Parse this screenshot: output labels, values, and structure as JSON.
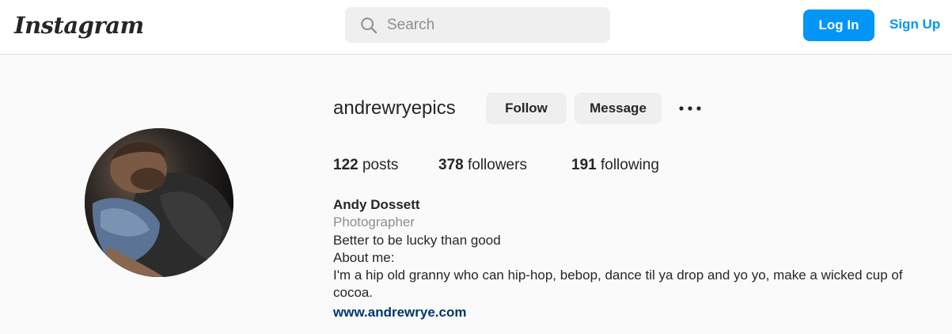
{
  "header": {
    "logo_text": "Instagram",
    "search": {
      "placeholder": "Search",
      "value": "",
      "icon": "search-icon"
    },
    "login_label": "Log In",
    "signup_label": "Sign Up"
  },
  "profile": {
    "username": "andrewryepics",
    "follow_label": "Follow",
    "message_label": "Message",
    "more_icon": "more-options-icon",
    "stats": {
      "posts_count": "122",
      "posts_label": "posts",
      "followers_count": "378",
      "followers_label": "followers",
      "following_count": "191",
      "following_label": "following"
    },
    "bio": {
      "full_name": "Andy Dossett",
      "category": "Photographer",
      "line1": "Better to be lucky than good",
      "line2": "About me:",
      "line3": "I'm a hip old granny who can hip-hop, bebop, dance til ya drop and yo yo, make a wicked cup of cocoa.",
      "website": "www.andrewrye.com"
    }
  },
  "colors": {
    "accent": "#0095f6",
    "link": "#00376b",
    "button_grey": "#efefef",
    "page_bg": "#fafafa",
    "muted_text": "#8e8e8e"
  }
}
